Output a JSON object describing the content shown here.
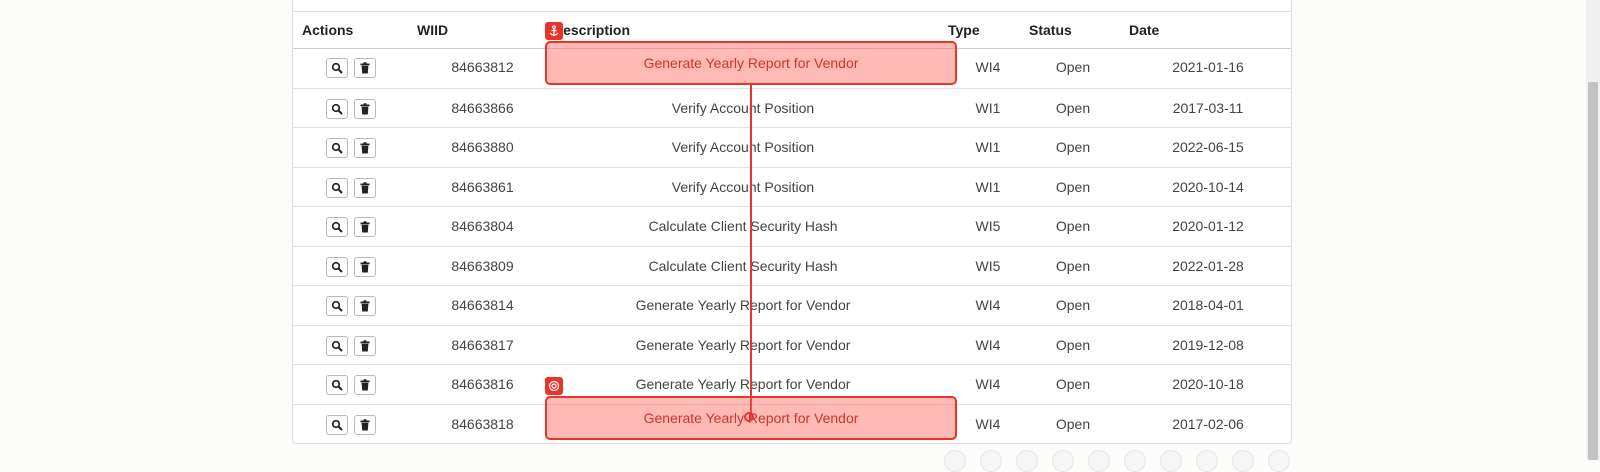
{
  "table": {
    "headers": {
      "actions": "Actions",
      "wiid": "WIID",
      "description": "Description",
      "type": "Type",
      "status": "Status",
      "date": "Date"
    },
    "rows": [
      {
        "wiid": "84663812",
        "description": "Generate Yearly Report for Vendor",
        "type": "WI4",
        "status": "Open",
        "date": "2021-01-16"
      },
      {
        "wiid": "84663866",
        "description": "Verify Account Position",
        "type": "WI1",
        "status": "Open",
        "date": "2017-03-11"
      },
      {
        "wiid": "84663880",
        "description": "Verify Account Position",
        "type": "WI1",
        "status": "Open",
        "date": "2022-06-15"
      },
      {
        "wiid": "84663861",
        "description": "Verify Account Position",
        "type": "WI1",
        "status": "Open",
        "date": "2020-10-14"
      },
      {
        "wiid": "84663804",
        "description": "Calculate Client Security Hash",
        "type": "WI5",
        "status": "Open",
        "date": "2020-01-12"
      },
      {
        "wiid": "84663809",
        "description": "Calculate Client Security Hash",
        "type": "WI5",
        "status": "Open",
        "date": "2022-01-28"
      },
      {
        "wiid": "84663814",
        "description": "Generate Yearly Report for Vendor",
        "type": "WI4",
        "status": "Open",
        "date": "2018-04-01"
      },
      {
        "wiid": "84663817",
        "description": "Generate Yearly Report for Vendor",
        "type": "WI4",
        "status": "Open",
        "date": "2019-12-08"
      },
      {
        "wiid": "84663816",
        "description": "Generate Yearly Report for Vendor",
        "type": "WI4",
        "status": "Open",
        "date": "2020-10-18"
      },
      {
        "wiid": "84663818",
        "description": "Generate Yearly Report for Vendor",
        "type": "WI4",
        "status": "Open",
        "date": "2017-02-06"
      }
    ],
    "row_actions": [
      "search-icon",
      "trash-icon"
    ]
  },
  "drag_overlay": {
    "source_label": "Generate Yearly Report for Vendor",
    "target_label": "Generate Yearly Report for Vendor",
    "source_marker_icon": "anchor-icon",
    "target_marker_icon": "target-icon",
    "color": "#e8342b"
  },
  "pagination_dots": 10
}
